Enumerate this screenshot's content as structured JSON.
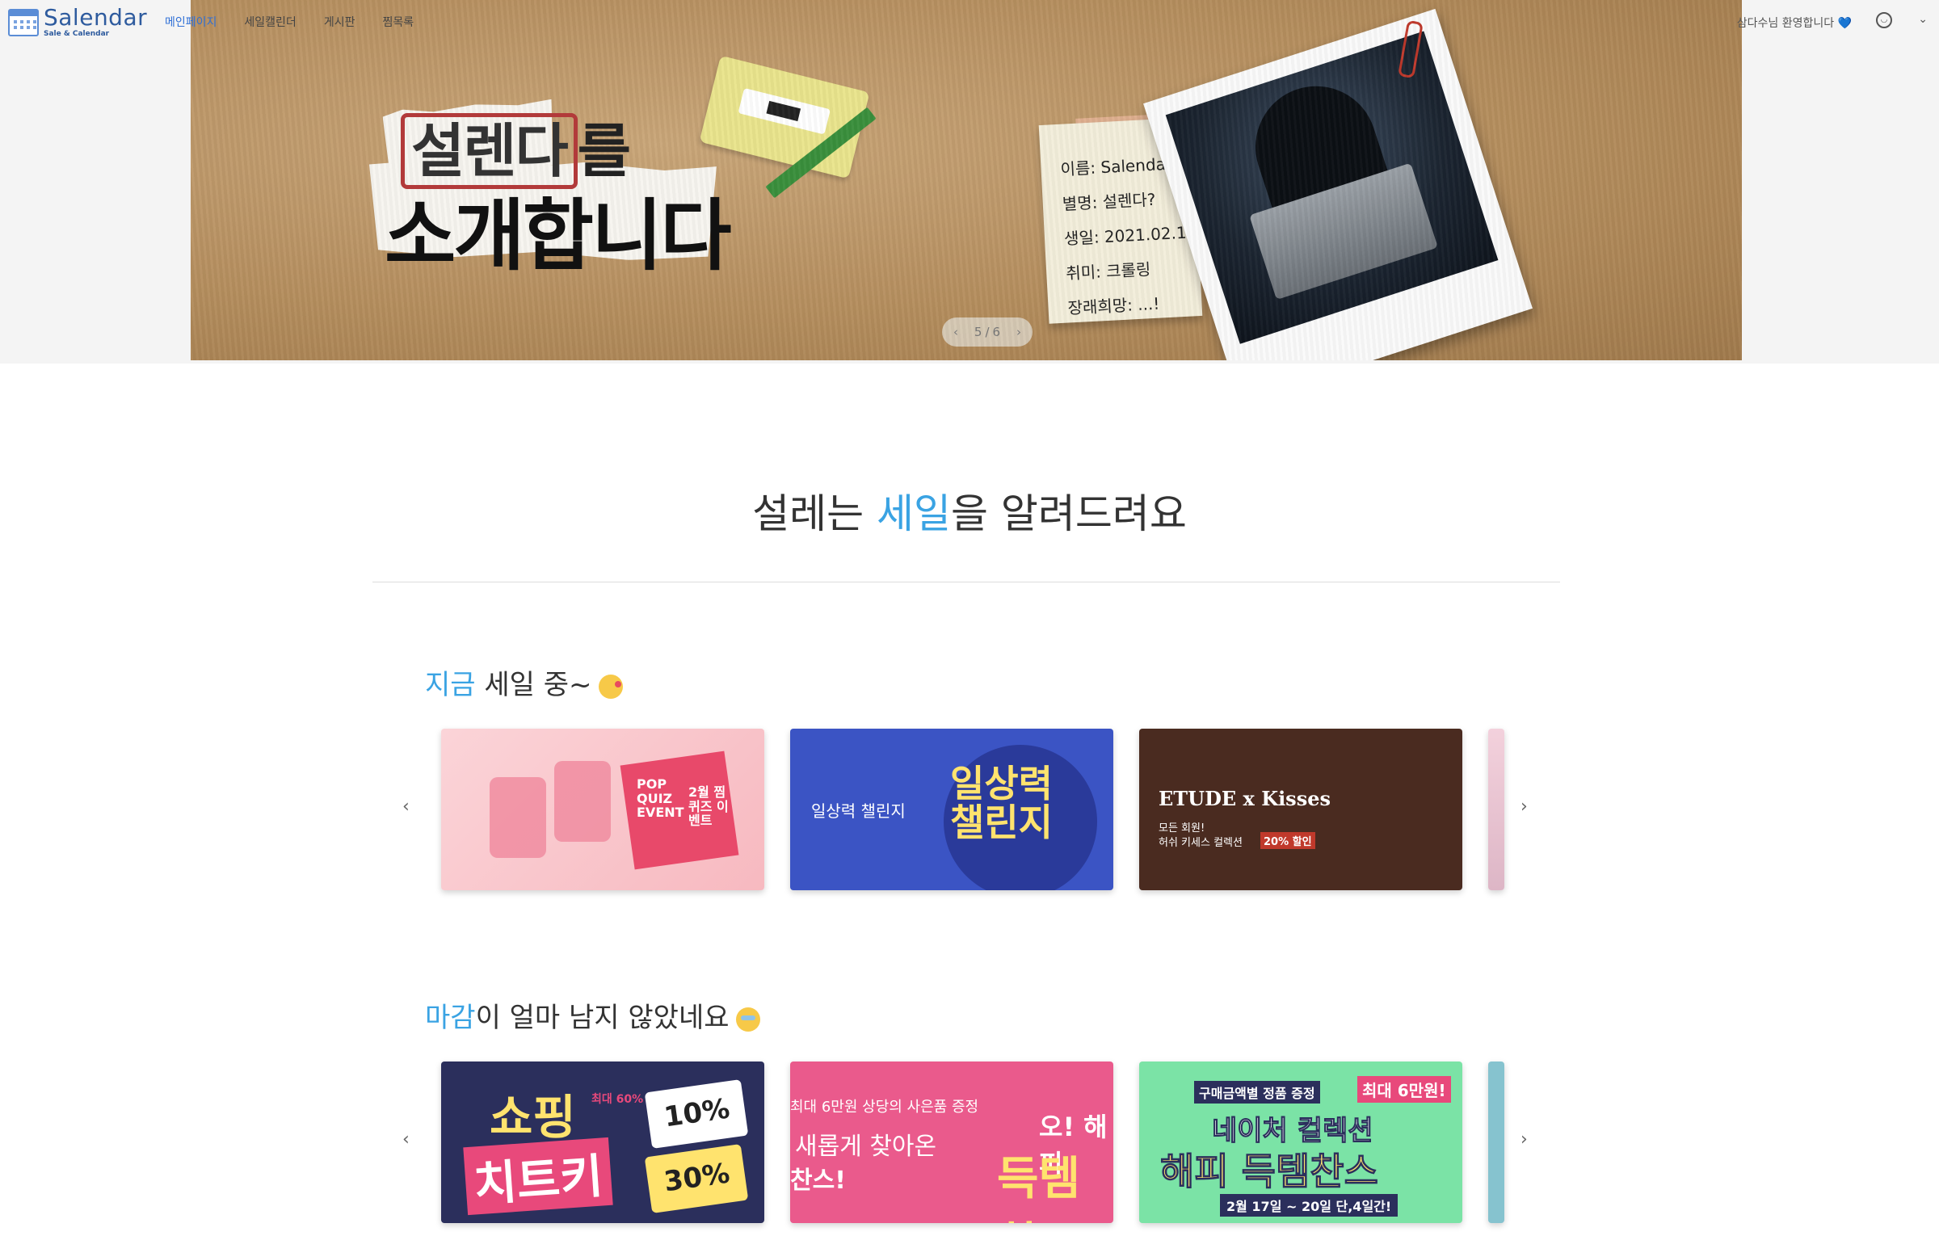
{
  "header": {
    "logo_title": "Salendar",
    "logo_sub": "Sale & Calendar",
    "menu": [
      "메인페이지",
      "세일캘린더",
      "게시판",
      "찜목록"
    ],
    "active_menu": 0,
    "welcome": "삼다수님 환영합니다",
    "welcome_heart": "💙",
    "user_icon": "smiley-icon",
    "dropdown_icon": "chevron-down-icon"
  },
  "hero": {
    "title_boxed": "설렌다",
    "title_suffix": "를",
    "title_line2": "소개합니다",
    "note_lines": [
      "이름: Salendar",
      "별명: 설렌다?",
      "생일: 2021.02.19",
      "취미: 크롤링",
      "장래희망: ...!"
    ],
    "pager_current": "5",
    "pager_sep": "/",
    "pager_total": "6",
    "prev": "‹",
    "next": "›"
  },
  "main": {
    "title_pre": "설레는 ",
    "title_hl": "세일",
    "title_post": "을 알려드려요"
  },
  "section1": {
    "title_hl": "지금",
    "title_rest": " 세일 중~",
    "emoji": "face-blowing-kiss",
    "cards": [
      {
        "text_a": "POP QUIZ EVENT",
        "text_b": "2월 찜퀴즈 이벤트"
      },
      {
        "text_a": "일상력 챌린지",
        "text_b": "일상력 챌린지"
      },
      {
        "text_a": "ETUDE x Kisses",
        "text_b": "모든 회원!",
        "text_c": "허쉬 키세스 컬렉션",
        "text_d": "20% 할인"
      },
      {
        "text_a": ""
      }
    ]
  },
  "section2": {
    "title_hl": "마감",
    "title_rest": "이 얼마 남지 않았네요",
    "emoji": "sad-relieved-face",
    "cards": [
      {
        "text_a": "쇼핑",
        "text_b": "치트키",
        "text_c": "최대 60%",
        "text_d": "10%",
        "text_e": "30%"
      },
      {
        "text_a": "최대 6만원 상당의 사은품 증정",
        "text_b": "새롭게 찾아온",
        "text_c": "찬스!",
        "text_d": "오! 해피",
        "text_e": "득템 찬"
      },
      {
        "text_a": "구매금액별 정품 증정",
        "text_b": "최대 6만원!",
        "text_c": "네이처 컬렉션",
        "text_d": "해피 득템찬스",
        "text_e": "2월 17일 ~ 20일 단,4일간!"
      },
      {
        "text_a": ""
      }
    ]
  },
  "carousel": {
    "prev": "‹",
    "next": "›"
  }
}
